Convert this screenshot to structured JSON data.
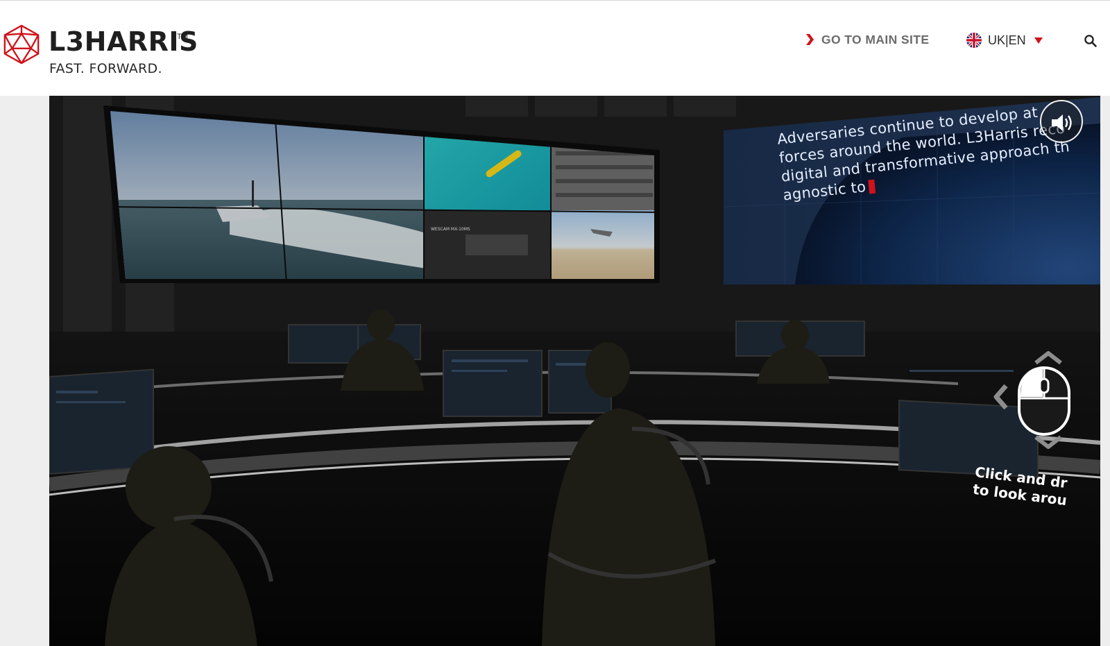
{
  "header": {
    "logo": {
      "name": "L3HARRIS",
      "tm": "TM",
      "tagline": "FAST. FORWARD."
    },
    "main_site_link": "GO TO MAIN SITE",
    "language": "UK|EN",
    "colors": {
      "brand_red": "#d0121b",
      "text_gray": "#6c6c6c"
    },
    "icons": [
      "logo-icosahedron-icon",
      "chevron-right-icon",
      "uk-flag-icon",
      "caret-down-icon",
      "search-icon"
    ]
  },
  "scene": {
    "wall_text_lines": [
      "Adversaries continue to develop at",
      "forces around the world. L3Harris reco",
      "digital and transformative approach th",
      "agnostic to"
    ],
    "video_wall_overlay": "WESCAM MX-10MS",
    "hint_lines": [
      "Click and dr",
      "to look arou"
    ],
    "icons": [
      "speaker-volume-icon",
      "mouse-drag-icon",
      "chevron-left-icon",
      "chevron-up-icon",
      "chevron-down-icon"
    ]
  }
}
